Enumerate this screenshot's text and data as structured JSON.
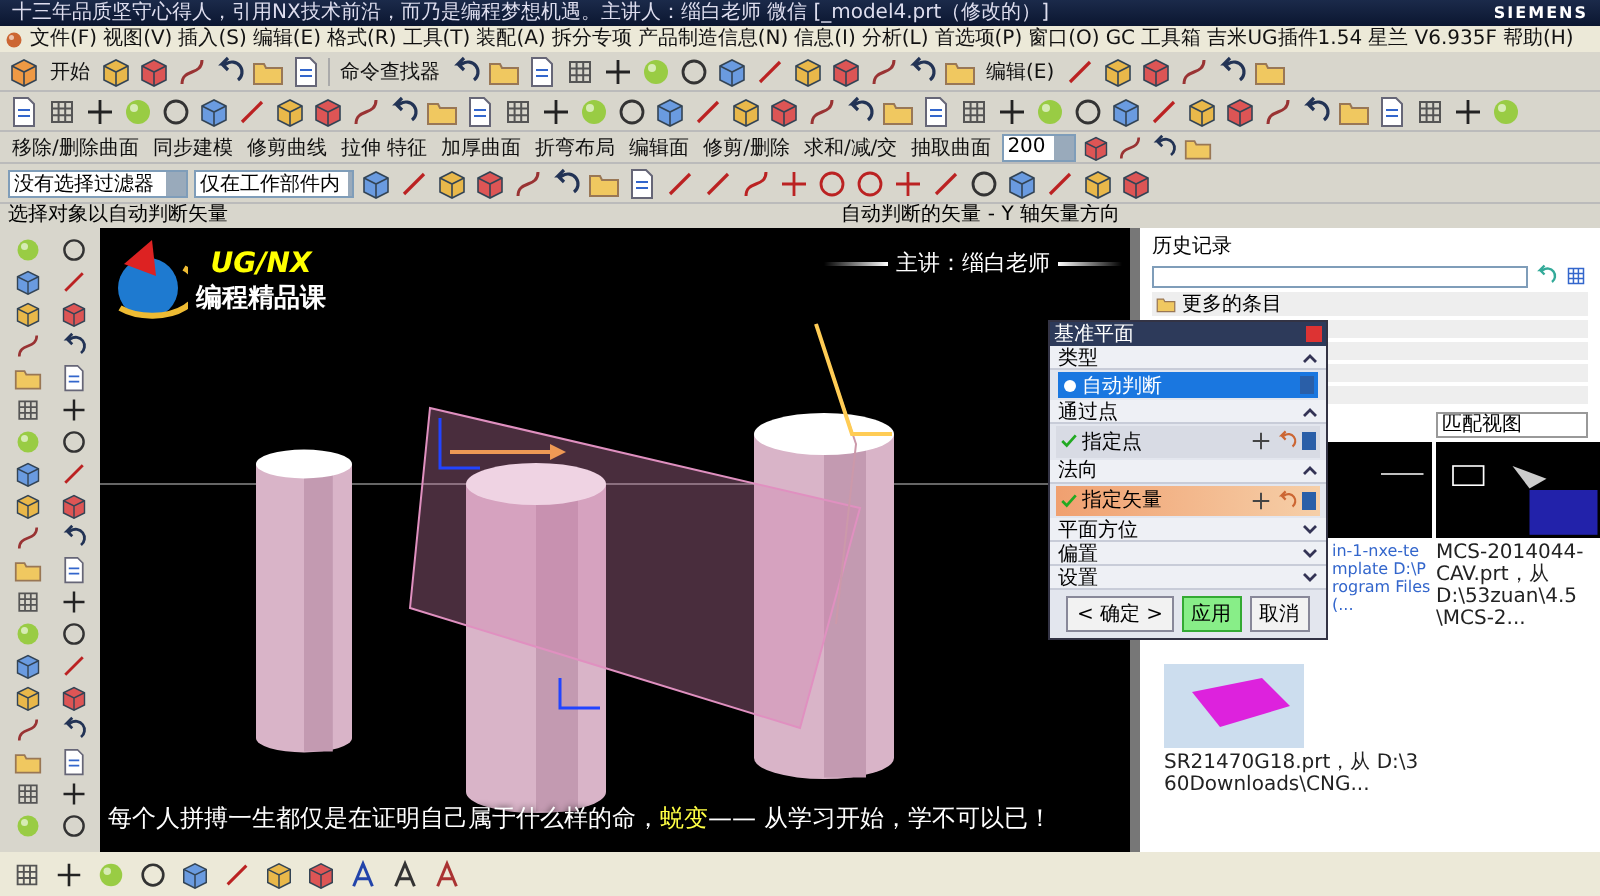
{
  "window": {
    "title": "十三年品质坚守心得人，引用NX技术前沿，而乃是编程梦想机遇。主讲人：缁白老师  微信  [_model4.prt（修改的）]",
    "brand": "SIEMENS"
  },
  "menu": [
    "文件(F)",
    "视图(V)",
    "插入(S)",
    "编辑(E)",
    "格式(R)",
    "工具(T)",
    "装配(A)",
    "拆分专项",
    "产品制造信息(N)",
    "信息(I)",
    "分析(L)",
    "首选项(P)",
    "窗口(O)",
    "GC 工具箱",
    "吉米UG插件1.54",
    "星兰 V6.935F",
    "帮助(H)"
  ],
  "toolbar": {
    "start": "开始",
    "command_finder": "命令查找器",
    "edit_menu": "编辑(E)"
  },
  "feature_toolbar": {
    "items": [
      "移除/删除曲面",
      "同步建模",
      "修剪曲线",
      "拉伸 特征",
      "加厚曲面",
      "折弯布局",
      "编辑面",
      "修剪/删除",
      "求和/减/交",
      "抽取曲面"
    ],
    "zoom": "200"
  },
  "filters": {
    "selection_filter": "没有选择过滤器",
    "scope": "仅在工作部件内"
  },
  "status_bar": {
    "prompt": "选择对象以自动判断矢量",
    "status": "自动判断的矢量 - Y 轴矢量方向"
  },
  "viewport": {
    "logo_title": "UG/NX",
    "logo_subtitle": "编程精品课",
    "presenter": "主讲：缁白老师",
    "subtitle": {
      "before": "每个人拼搏一生都仅是在证明自己属于什么样的命，",
      "highlight": "蜕变",
      "after": "—— 从学习开始，学不可以已！"
    }
  },
  "dialog": {
    "title": "基准平面",
    "sections": [
      {
        "label": "类型",
        "expanded": true,
        "kind": "dropdown",
        "value": "自动判断"
      },
      {
        "label": "通过点",
        "expanded": true,
        "kind": "picker",
        "value": "指定点",
        "active": false
      },
      {
        "label": "法向",
        "expanded": true,
        "kind": "picker",
        "value": "指定矢量",
        "active": true
      },
      {
        "label": "平面方位",
        "expanded": false,
        "kind": "group"
      },
      {
        "label": "偏置",
        "expanded": false,
        "kind": "group"
      },
      {
        "label": "设置",
        "expanded": false,
        "kind": "group"
      }
    ],
    "buttons": [
      {
        "label": "< 确定 >",
        "default": false
      },
      {
        "label": "应用",
        "default": true
      },
      {
        "label": "取消",
        "default": false
      }
    ]
  },
  "history": {
    "title": "历史记录",
    "groups": [
      "更多的条目"
    ],
    "thumbnails": [
      {
        "caption": "in-1-nxe-template D:\\Program Files (...",
        "kind": "dark"
      },
      {
        "header": "匹配视图",
        "caption": "MCS-2014044-CAV.prt，从 D:\\53zuan\\4.5\\MCS-2...",
        "kind": "blueprint"
      },
      {
        "caption": "SR21470G18.prt，从 D:\\360Downloads\\CNG...",
        "kind": "part"
      }
    ]
  }
}
